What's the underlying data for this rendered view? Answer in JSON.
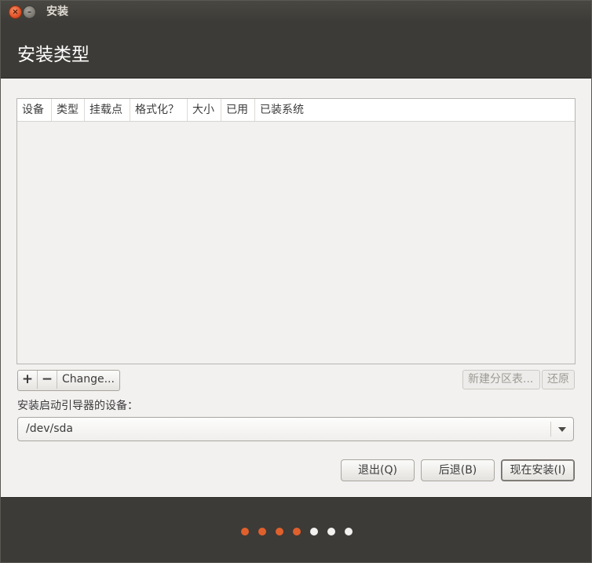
{
  "window": {
    "title": "安装",
    "close_glyph": "×",
    "minimize_glyph": "–"
  },
  "page": {
    "title": "安装类型"
  },
  "partition_table": {
    "columns": [
      "设备",
      "类型",
      "挂载点",
      "格式化？",
      "大小",
      "已用",
      "已装系统"
    ],
    "rows": []
  },
  "toolbar": {
    "add_label": "+",
    "remove_label": "−",
    "change_label": "Change...",
    "new_table_label": "新建分区表...",
    "revert_label": "还原"
  },
  "bootloader": {
    "label": "安装启动引导器的设备：",
    "selected_value": "/dev/sda"
  },
  "actions": {
    "quit_label": "退出(Q)",
    "back_label": "后退(B)",
    "install_label": "现在安装(I)"
  },
  "progress": {
    "total_steps": 7,
    "completed_steps": 4,
    "active_color": "#e0602c",
    "inactive_color": "#f2f1f0"
  },
  "colors": {
    "header_bg": "#3c3b37",
    "content_bg": "#f2f1f0"
  }
}
